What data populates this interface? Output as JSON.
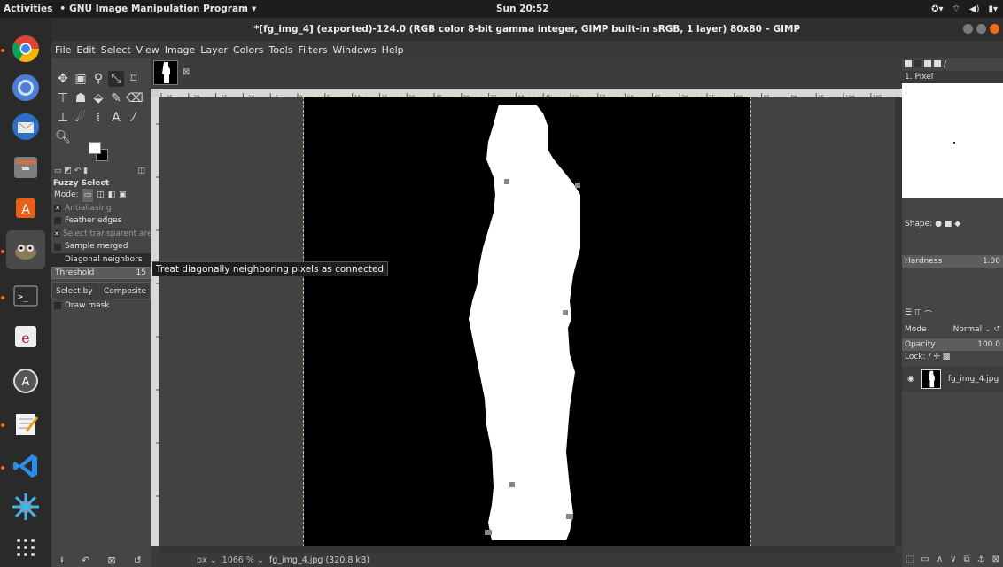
{
  "topbar": {
    "activities": "Activities",
    "app_menu": "GNU Image Manipulation Program",
    "clock": "Sun 20:52"
  },
  "window": {
    "title": "*[fg_img_4] (exported)-124.0 (RGB color 8-bit gamma integer, GIMP built-in sRGB, 1 layer) 80x80 – GIMP"
  },
  "menubar": [
    "File",
    "Edit",
    "Select",
    "View",
    "Image",
    "Layer",
    "Colors",
    "Tools",
    "Filters",
    "Windows",
    "Help"
  ],
  "tool_options": {
    "title": "Fuzzy Select",
    "mode_label": "Mode:",
    "antialiasing": "Antialiasing",
    "feather_edges": "Feather edges",
    "select_transparent": "Select transparent area",
    "sample_merged": "Sample merged",
    "diagonal_neighbors": "Diagonal neighbors",
    "threshold_label": "Threshold",
    "threshold_value": "15",
    "select_by_label": "Select by",
    "select_by_value": "Composite",
    "draw_mask": "Draw mask"
  },
  "tooltip": "Treat diagonally neighboring pixels as connected",
  "status": {
    "unit": "px",
    "zoom": "1066 %",
    "file": "fg_img_4.jpg (320.8 kB)"
  },
  "ruler_top": [
    "-25",
    "-20",
    "-15",
    "-10",
    "-5",
    "0",
    "5",
    "10",
    "15",
    "20",
    "25",
    "30",
    "35",
    "40",
    "45",
    "50",
    "55",
    "60",
    "65",
    "70",
    "75",
    "80",
    "85",
    "90",
    "95",
    "100",
    "105"
  ],
  "right_panel": {
    "brush_name": "1. Pixel",
    "shape_label": "Shape:",
    "hardness_label": "Hardness",
    "hardness_value": "1.00",
    "mode_label": "Mode",
    "mode_value": "Normal",
    "opacity_label": "Opacity",
    "opacity_value": "100.0",
    "lock_label": "Lock:",
    "layer_name": "fg_img_4.jpg"
  }
}
